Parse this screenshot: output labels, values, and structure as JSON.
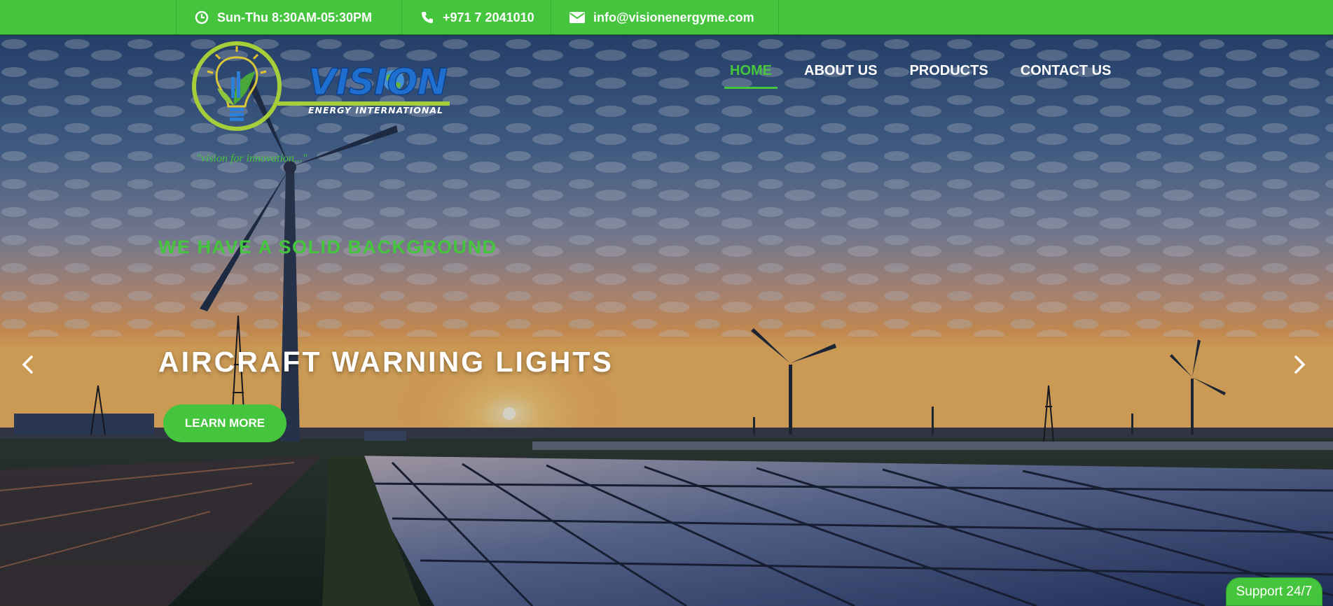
{
  "topbar": {
    "hours": "Sun-Thu 8:30AM-05:30PM",
    "phone": "+971 7 2041010",
    "email": "info@visionenergyme.com",
    "icons": [
      "clock-icon",
      "phone-icon",
      "envelope-icon"
    ]
  },
  "logo": {
    "brand": "VISION",
    "subtitle": "ENERGY INTERNATIONAL",
    "tagline": "\"vision for innovation...\""
  },
  "nav": {
    "items": [
      {
        "label": "HOME",
        "active": true
      },
      {
        "label": "ABOUT US",
        "active": false
      },
      {
        "label": "PRODUCTS",
        "active": false
      },
      {
        "label": "CONTACT US",
        "active": false
      }
    ]
  },
  "hero": {
    "kicker": "WE HAVE A SOLID BACKGROUND",
    "headline": "AIRCRAFT WARNING LIGHTS",
    "cta_label": "LEARN MORE"
  },
  "support_label": "Support 24/7",
  "colors": {
    "accent": "#45c43d",
    "brand_blue": "#1f6fd0",
    "text_light": "#ffffff"
  }
}
